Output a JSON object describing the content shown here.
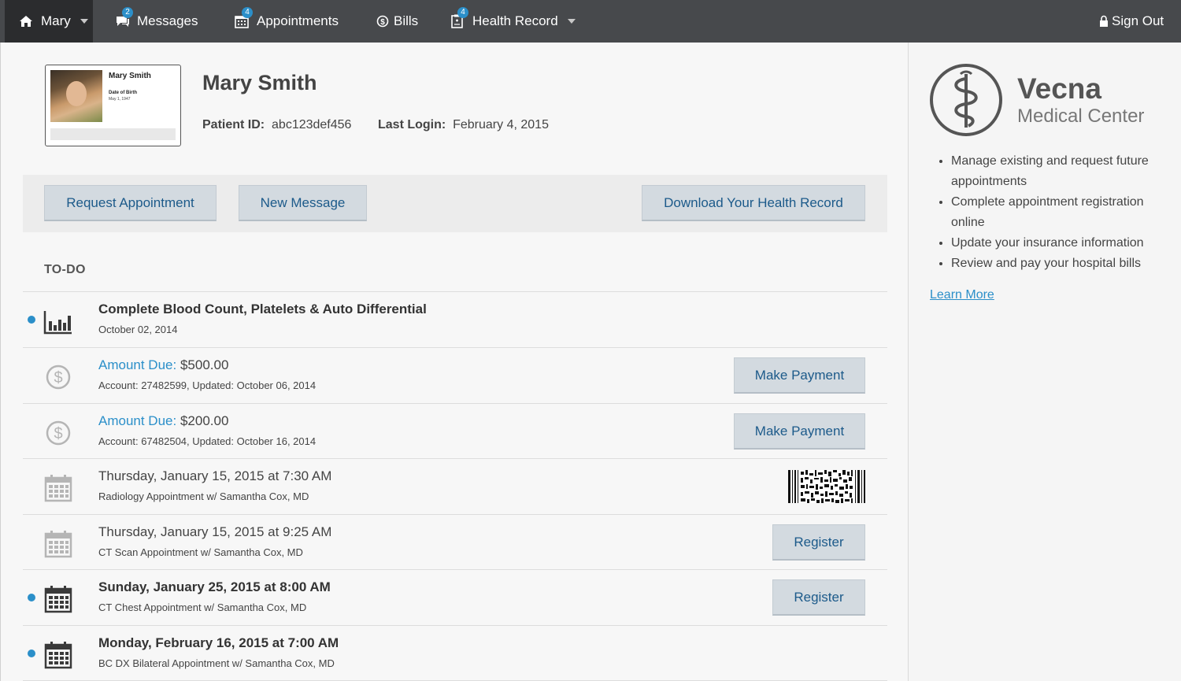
{
  "nav": {
    "user": "Mary",
    "messages": {
      "label": "Messages",
      "badge": "2"
    },
    "appointments": {
      "label": "Appointments",
      "badge": "4"
    },
    "bills": {
      "label": "Bills"
    },
    "health_record": {
      "label": "Health Record",
      "badge": "4"
    },
    "sign_out": "Sign Out"
  },
  "patient": {
    "card_name": "Mary Smith",
    "card_dob_label": "Date of Birth",
    "card_dob": "May 1, 1947",
    "name": "Mary Smith",
    "id_label": "Patient ID:",
    "id": "abc123def456",
    "last_login_label": "Last Login:",
    "last_login": "February 4, 2015"
  },
  "actions": {
    "request_appointment": "Request Appointment",
    "new_message": "New Message",
    "download_record": "Download Your Health Record"
  },
  "todo": {
    "title": "TO-DO",
    "items": [
      {
        "title": "Complete Blood Count, Platelets & Auto Differential",
        "sub": "October 02, 2014",
        "icon": "chart-icon",
        "unread": true
      },
      {
        "prefix": "Amount Due:",
        "amount": "$500.00",
        "sub": "Account: 27482599, Updated: October 06, 2014",
        "icon": "dollar-icon",
        "action": "Make Payment"
      },
      {
        "prefix": "Amount Due:",
        "amount": "$200.00",
        "sub": "Account: 67482504, Updated: October 16, 2014",
        "icon": "dollar-icon",
        "action": "Make Payment"
      },
      {
        "title": "Thursday, January 15, 2015 at 7:30 AM",
        "sub": "Radiology Appointment w/ Samantha Cox, MD",
        "icon": "calendar-icon",
        "barcode": true
      },
      {
        "title": "Thursday, January 15, 2015 at 9:25 AM",
        "sub": "CT Scan Appointment w/ Samantha Cox, MD",
        "icon": "calendar-icon",
        "action": "Register"
      },
      {
        "title": "Sunday, January 25, 2015 at 8:00 AM",
        "sub": "CT Chest Appointment w/ Samantha Cox, MD",
        "icon": "calendar-icon",
        "action": "Register",
        "unread": true
      },
      {
        "title": "Monday, February 16, 2015 at 7:00 AM",
        "sub": "BC DX Bilateral Appointment w/ Samantha Cox, MD",
        "icon": "calendar-icon",
        "unread": true
      }
    ]
  },
  "sidebar": {
    "brand": "Vecna",
    "brand_sub": "Medical Center",
    "benefits": [
      "Manage existing and request future appointments",
      "Complete appointment registration online",
      "Update your insurance information",
      "Review and pay your hospital bills"
    ],
    "learn_more": "Learn More"
  },
  "colors": {
    "nav_bg": "#47494c",
    "accent": "#2b8fc9",
    "button_bg": "#d3dae0",
    "button_text": "#1c5a8a"
  }
}
